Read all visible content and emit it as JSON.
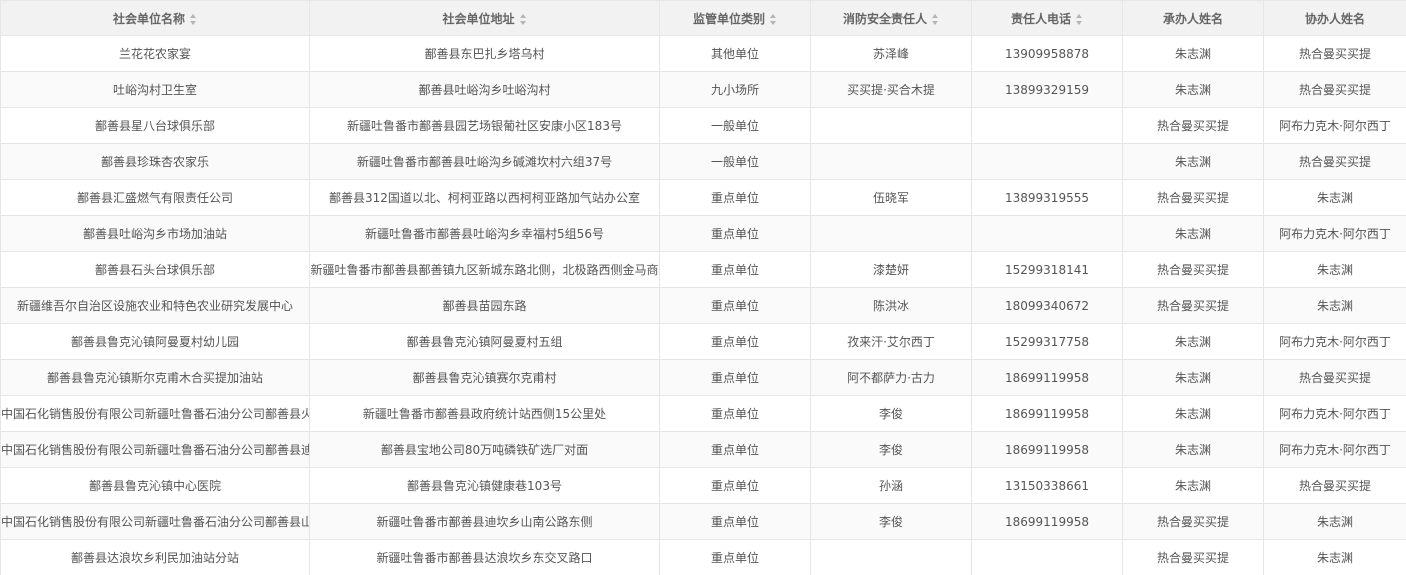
{
  "colors": {
    "其他单位": "#5fb878",
    "九小场所": "#f0a030",
    "一般单位": "#1e9fff",
    "重点单位": "#ff5722"
  },
  "columns": [
    "社会单位名称",
    "社会单位地址",
    "监管单位类别",
    "消防安全责任人",
    "责任人电话",
    "承办人姓名",
    "协办人姓名"
  ],
  "rows": [
    {
      "name": "兰花花农家宴",
      "address": "鄯善县东巴扎乡塔乌村",
      "category": "其他单位",
      "responsible": "苏泽峰",
      "phone": "13909958878",
      "handler": "朱志渊",
      "assistant": "热合曼买买提"
    },
    {
      "name": "吐峪沟村卫生室",
      "address": "鄯善县吐峪沟乡吐峪沟村",
      "category": "九小场所",
      "responsible": "买买提·买合木提",
      "phone": "13899329159",
      "handler": "朱志渊",
      "assistant": "热合曼买买提"
    },
    {
      "name": "鄯善县星八台球俱乐部",
      "address": "新疆吐鲁番市鄯善县园艺场银葡社区安康小区183号",
      "category": "一般单位",
      "responsible": "",
      "phone": "",
      "handler": "热合曼买买提",
      "assistant": "阿布力克木·阿尔西丁"
    },
    {
      "name": "鄯善县珍珠杏农家乐",
      "address": "新疆吐鲁番市鄯善县吐峪沟乡碱滩坎村六组37号",
      "category": "一般单位",
      "responsible": "",
      "phone": "",
      "handler": "朱志渊",
      "assistant": "热合曼买买提"
    },
    {
      "name": "鄯善县汇盛燃气有限责任公司",
      "address": "鄯善县312国道以北、柯柯亚路以西柯柯亚路加气站办公室",
      "category": "重点单位",
      "responsible": "伍晓军",
      "phone": "13899319555",
      "handler": "热合曼买买提",
      "assistant": "朱志渊"
    },
    {
      "name": "鄯善县吐峪沟乡市场加油站",
      "address": "新疆吐鲁番市鄯善县吐峪沟乡幸福村5组56号",
      "category": "重点单位",
      "responsible": "",
      "phone": "",
      "handler": "朱志渊",
      "assistant": "阿布力克木·阿尔西丁"
    },
    {
      "name": "鄯善县石头台球俱乐部",
      "address": "新疆吐鲁番市鄯善县鄯善镇九区新城东路北侧，北极路西侧金马商",
      "category": "重点单位",
      "responsible": "漆楚妍",
      "phone": "15299318141",
      "handler": "热合曼买买提",
      "assistant": "朱志渊"
    },
    {
      "name": "新疆维吾尔自治区设施农业和特色农业研究发展中心",
      "address": "鄯善县苗园东路",
      "category": "重点单位",
      "responsible": "陈洪冰",
      "phone": "18099340672",
      "handler": "热合曼买买提",
      "assistant": "朱志渊"
    },
    {
      "name": "鄯善县鲁克沁镇阿曼夏村幼儿园",
      "address": "鄯善县鲁克沁镇阿曼夏村五组",
      "category": "重点单位",
      "responsible": "孜来汗·艾尔西丁",
      "phone": "15299317758",
      "handler": "朱志渊",
      "assistant": "阿布力克木·阿尔西丁"
    },
    {
      "name": "鄯善县鲁克沁镇斯尔克甫木合买提加油站",
      "address": "鄯善县鲁克沁镇赛尔克甫村",
      "category": "重点单位",
      "responsible": "阿不都萨力·古力",
      "phone": "18699119958",
      "handler": "朱志渊",
      "assistant": "热合曼买买提"
    },
    {
      "name": "中国石化销售股份有限公司新疆吐鲁番石油分公司鄯善县火",
      "address": "新疆吐鲁番市鄯善县政府统计站西侧15公里处",
      "category": "重点单位",
      "responsible": "李俊",
      "phone": "18699119958",
      "handler": "朱志渊",
      "assistant": "阿布力克木·阿尔西丁"
    },
    {
      "name": "中国石化销售股份有限公司新疆吐鲁番石油分公司鄯善县迪",
      "address": "鄯善县宝地公司80万吨磷铁矿选厂对面",
      "category": "重点单位",
      "responsible": "李俊",
      "phone": "18699119958",
      "handler": "朱志渊",
      "assistant": "阿布力克木·阿尔西丁"
    },
    {
      "name": "鄯善县鲁克沁镇中心医院",
      "address": "鄯善县鲁克沁镇健康巷103号",
      "category": "重点单位",
      "responsible": "孙涵",
      "phone": "13150338661",
      "handler": "朱志渊",
      "assistant": "热合曼买买提"
    },
    {
      "name": "中国石化销售股份有限公司新疆吐鲁番石油分公司鄯善县山",
      "address": "新疆吐鲁番市鄯善县迪坎乡山南公路东侧",
      "category": "重点单位",
      "responsible": "李俊",
      "phone": "18699119958",
      "handler": "热合曼买买提",
      "assistant": "朱志渊"
    },
    {
      "name": "鄯善县达浪坎乡利民加油站分站",
      "address": "新疆吐鲁番市鄯善县达浪坎乡东交叉路口",
      "category": "重点单位",
      "responsible": "",
      "phone": "",
      "handler": "热合曼买买提",
      "assistant": "朱志渊"
    }
  ]
}
